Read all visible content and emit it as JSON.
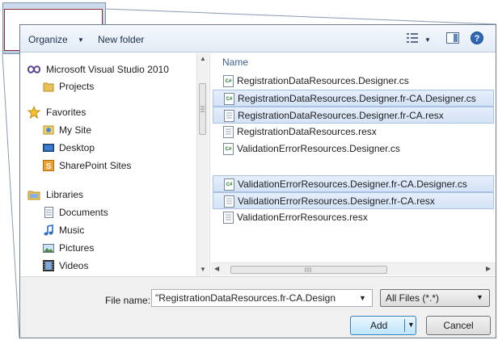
{
  "toolbar": {
    "organize_label": "Organize",
    "new_folder_label": "New folder",
    "views_icon": "views-icon",
    "preview_icon": "preview-pane-icon",
    "help_icon": "help-icon"
  },
  "nav": {
    "groups": [
      {
        "label": "Microsoft Visual Studio 2010",
        "icon": "visual-studio-icon"
      },
      {
        "label": "Projects",
        "icon": "folder-icon"
      },
      {
        "label": "Favorites",
        "icon": "star-icon"
      },
      {
        "label": "My Site",
        "icon": "my-site-icon"
      },
      {
        "label": "Desktop",
        "icon": "desktop-icon"
      },
      {
        "label": "SharePoint Sites",
        "icon": "sharepoint-icon"
      },
      {
        "label": "Libraries",
        "icon": "libraries-icon"
      },
      {
        "label": "Documents",
        "icon": "documents-icon"
      },
      {
        "label": "Music",
        "icon": "music-icon"
      },
      {
        "label": "Pictures",
        "icon": "pictures-icon"
      },
      {
        "label": "Videos",
        "icon": "videos-icon"
      }
    ]
  },
  "files": {
    "column_header": "Name",
    "items": [
      {
        "name": "RegistrationDataResources.Designer.cs",
        "type": "cs",
        "selected": false
      },
      {
        "name": "RegistrationDataResources.Designer.fr-CA.Designer.cs",
        "type": "cs",
        "selected": true
      },
      {
        "name": "RegistrationDataResources.Designer.fr-CA.resx",
        "type": "resx",
        "selected": true
      },
      {
        "name": "RegistrationDataResources.resx",
        "type": "resx",
        "selected": false
      },
      {
        "name": "ValidationErrorResources.Designer.cs",
        "type": "cs",
        "selected": false
      },
      {
        "name": "ValidationErrorResources.Designer.fr-CA.Designer.cs",
        "type": "cs",
        "selected": true
      },
      {
        "name": "ValidationErrorResources.Designer.fr-CA.resx",
        "type": "resx",
        "selected": true
      },
      {
        "name": "ValidationErrorResources.resx",
        "type": "resx",
        "selected": false
      }
    ]
  },
  "bottom": {
    "file_name_label": "File name:",
    "file_name_value": "\"RegistrationDataResources.fr-CA.Design",
    "filter_value": "All Files (*.*)",
    "add_label": "Add",
    "cancel_label": "Cancel"
  },
  "colors": {
    "selection_bg": "#d4e3f7",
    "selection_border": "#a9c2e3",
    "callout_border": "#8b2d2d",
    "header_text": "#3b5f8f"
  }
}
